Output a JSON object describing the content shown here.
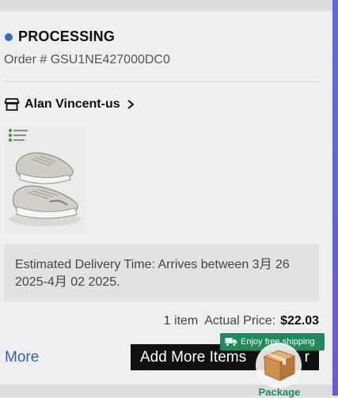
{
  "order": {
    "status": "PROCESSING",
    "status_color": "#2b6cc4",
    "order_number": "Order # GSU1NE427000DC0"
  },
  "store": {
    "name": "Alan Vincent-us",
    "icon": "store-icon",
    "chevron": "chevron-right-icon"
  },
  "product": {
    "image": "sneakers-product-image"
  },
  "delivery": {
    "text": "Estimated Delivery Time: Arrives between 3月 26 2025-4月 02 2025."
  },
  "summary": {
    "item_count": "1 item",
    "price_label": "Actual Price:",
    "price_value": "$22.03"
  },
  "actions": {
    "more_label": "More",
    "add_more_label": "Add More Items",
    "add_more_tail": "r"
  },
  "shipping_badge": {
    "text": "Enjoy free shipping",
    "color": "#1f8a5c"
  },
  "package_fab": {
    "label": "Package"
  },
  "colors": {
    "accent_blue": "#2f64b5",
    "button_black": "#111111",
    "edge_purple": "#5b6bd8"
  }
}
